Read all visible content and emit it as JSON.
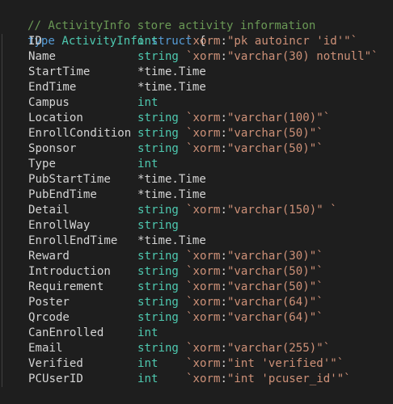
{
  "comment": "// ActivityInfo store activity information",
  "header": {
    "kw_type": "type",
    "name": "ActivityInfo",
    "kw_struct": "struct",
    "open_brace": "{"
  },
  "close_brace": "}",
  "fields": [
    {
      "name": "ID",
      "type": "int",
      "type_kind": "builtin",
      "tag_key": "`xorm",
      "tag_value": "\"pk autoincr 'id'\"`"
    },
    {
      "name": "Name",
      "type": "string",
      "type_kind": "builtin",
      "tag_key": "`xorm",
      "tag_value": "\"varchar(30) notnull\"`"
    },
    {
      "name": "StartTime",
      "type": "*time.Time",
      "type_kind": "plain",
      "tag_key": "",
      "tag_value": ""
    },
    {
      "name": "EndTime",
      "type": "*time.Time",
      "type_kind": "plain",
      "tag_key": "",
      "tag_value": ""
    },
    {
      "name": "Campus",
      "type": "int",
      "type_kind": "builtin",
      "tag_key": "",
      "tag_value": ""
    },
    {
      "name": "Location",
      "type": "string",
      "type_kind": "builtin",
      "tag_key": "`xorm",
      "tag_value": "\"varchar(100)\"`"
    },
    {
      "name": "EnrollCondition",
      "type": "string",
      "type_kind": "builtin",
      "tag_key": "`xorm",
      "tag_value": "\"varchar(50)\"`"
    },
    {
      "name": "Sponsor",
      "type": "string",
      "type_kind": "builtin",
      "tag_key": "`xorm",
      "tag_value": "\"varchar(50)\"`"
    },
    {
      "name": "Type",
      "type": "int",
      "type_kind": "builtin",
      "tag_key": "",
      "tag_value": ""
    },
    {
      "name": "PubStartTime",
      "type": "*time.Time",
      "type_kind": "plain",
      "tag_key": "",
      "tag_value": ""
    },
    {
      "name": "PubEndTime",
      "type": "*time.Time",
      "type_kind": "plain",
      "tag_key": "",
      "tag_value": ""
    },
    {
      "name": "Detail",
      "type": "string",
      "type_kind": "builtin",
      "tag_key": "`xorm",
      "tag_value": "\"varchar(150)\" `"
    },
    {
      "name": "EnrollWay",
      "type": "string",
      "type_kind": "builtin",
      "tag_key": "",
      "tag_value": ""
    },
    {
      "name": "EnrollEndTime",
      "type": "*time.Time",
      "type_kind": "plain",
      "tag_key": "",
      "tag_value": ""
    },
    {
      "name": "Reward",
      "type": "string",
      "type_kind": "builtin",
      "tag_key": "`xorm",
      "tag_value": "\"varchar(30)\"`"
    },
    {
      "name": "Introduction",
      "type": "string",
      "type_kind": "builtin",
      "tag_key": "`xorm",
      "tag_value": "\"varchar(50)\"`"
    },
    {
      "name": "Requirement",
      "type": "string",
      "type_kind": "builtin",
      "tag_key": "`xorm",
      "tag_value": "\"varchar(50)\"`"
    },
    {
      "name": "Poster",
      "type": "string",
      "type_kind": "builtin",
      "tag_key": "`xorm",
      "tag_value": "\"varchar(64)\"`"
    },
    {
      "name": "Qrcode",
      "type": "string",
      "type_kind": "builtin",
      "tag_key": "`xorm",
      "tag_value": "\"varchar(64)\"`"
    },
    {
      "name": "CanEnrolled",
      "type": "int",
      "type_kind": "builtin",
      "tag_key": "",
      "tag_value": ""
    },
    {
      "name": "Email",
      "type": "string",
      "type_kind": "builtin",
      "tag_key": "`xorm",
      "tag_value": "\"varchar(255)\"`"
    },
    {
      "name": "Verified",
      "type": "int",
      "type_kind": "builtin",
      "tag_key": "`xorm",
      "tag_value": "\"int 'verified'\"`"
    },
    {
      "name": "PCUserID",
      "type": "int",
      "type_kind": "builtin",
      "tag_key": "`xorm",
      "tag_value": "\"int 'pcuser_id'\"`"
    }
  ],
  "colors": {
    "background": "#1e1e1e",
    "comment": "#6a9955",
    "keyword": "#569cd6",
    "type": "#4ec9b0",
    "string": "#ce9178",
    "text": "#d4d4d4"
  }
}
